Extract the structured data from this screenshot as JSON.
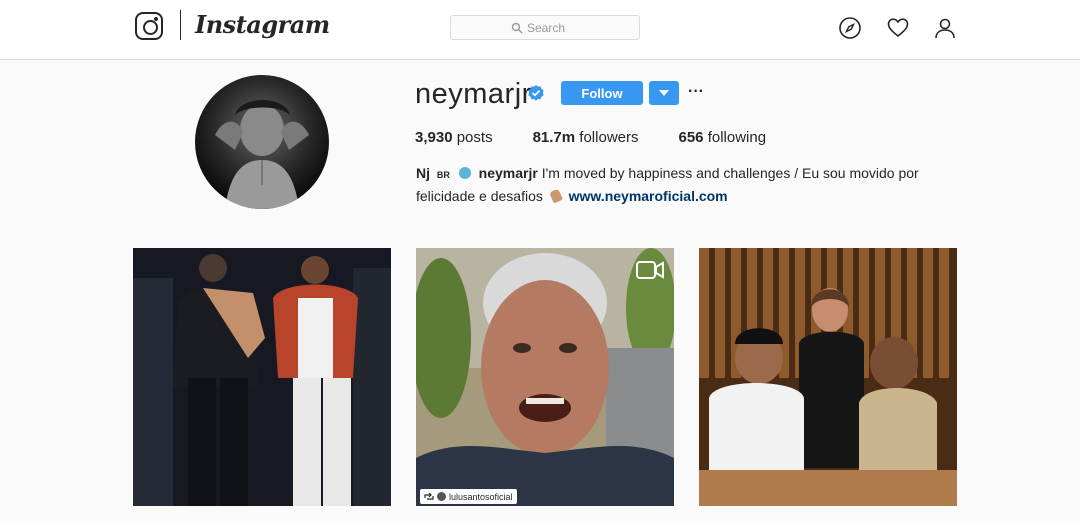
{
  "header": {
    "wordmark": "Instagram",
    "search_placeholder": "Search",
    "icons": [
      "instagram-logo-icon",
      "search-icon",
      "compass-icon",
      "heart-icon",
      "user-icon"
    ]
  },
  "profile": {
    "username": "neymarjr",
    "verified": true,
    "follow_label": "Follow",
    "more_label": "···",
    "stats": {
      "posts_count": "3,930",
      "posts_label": "posts",
      "followers_count": "81.7m",
      "followers_label": "followers",
      "following_count": "656",
      "following_label": "following"
    },
    "bio": {
      "name": "Nj",
      "flag": "BR",
      "handle": "neymarjr",
      "text_line1": "I'm moved by happiness and challenges / Eu sou movido por",
      "text_line2": "felicidade e desafios",
      "link": "www.neymaroficial.com"
    }
  },
  "posts": [
    {
      "kind": "image"
    },
    {
      "kind": "video",
      "repost_handle": "lulusantosoficial"
    },
    {
      "kind": "image"
    }
  ],
  "colors": {
    "accent": "#3897f0",
    "link": "#003569",
    "border": "#dbdbdb",
    "background": "#fafafa"
  }
}
